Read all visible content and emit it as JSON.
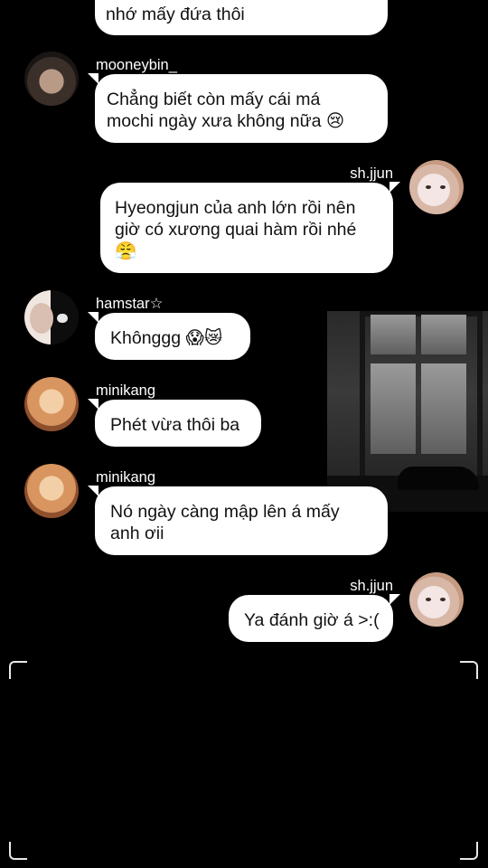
{
  "messages": [
    {
      "sender": "",
      "avatar": "",
      "text": "nhớ mấy đứa thôi"
    },
    {
      "sender": "mooneybin_",
      "avatar": "avatar-photo",
      "text": "Chẳng biết còn mấy cái má\nmochi ngày xưa không nữa 😢"
    },
    {
      "sender": "sh.jjun",
      "avatar": "avatar-photo",
      "text": "Hyeongjun của anh lớn rồi nên\ngiờ có xương quai hàm rồi nhé\n😤"
    },
    {
      "sender": "hamstar☆",
      "avatar": "avatar-photo",
      "text": "Khônggg 😱😿"
    },
    {
      "sender": "minikang",
      "avatar": "avatar-photo",
      "text": "Phét vừa thôi ba"
    },
    {
      "sender": "minikang",
      "avatar": "avatar-photo",
      "text": "Nó ngày càng mập lên á mấy\nanh ơii"
    },
    {
      "sender": "sh.jjun",
      "avatar": "avatar-photo",
      "text": "Ya đánh giờ á >:("
    }
  ],
  "colors": {
    "background": "#000000",
    "bubble": "#ffffff",
    "text": "#111111",
    "username": "#ffffff"
  }
}
